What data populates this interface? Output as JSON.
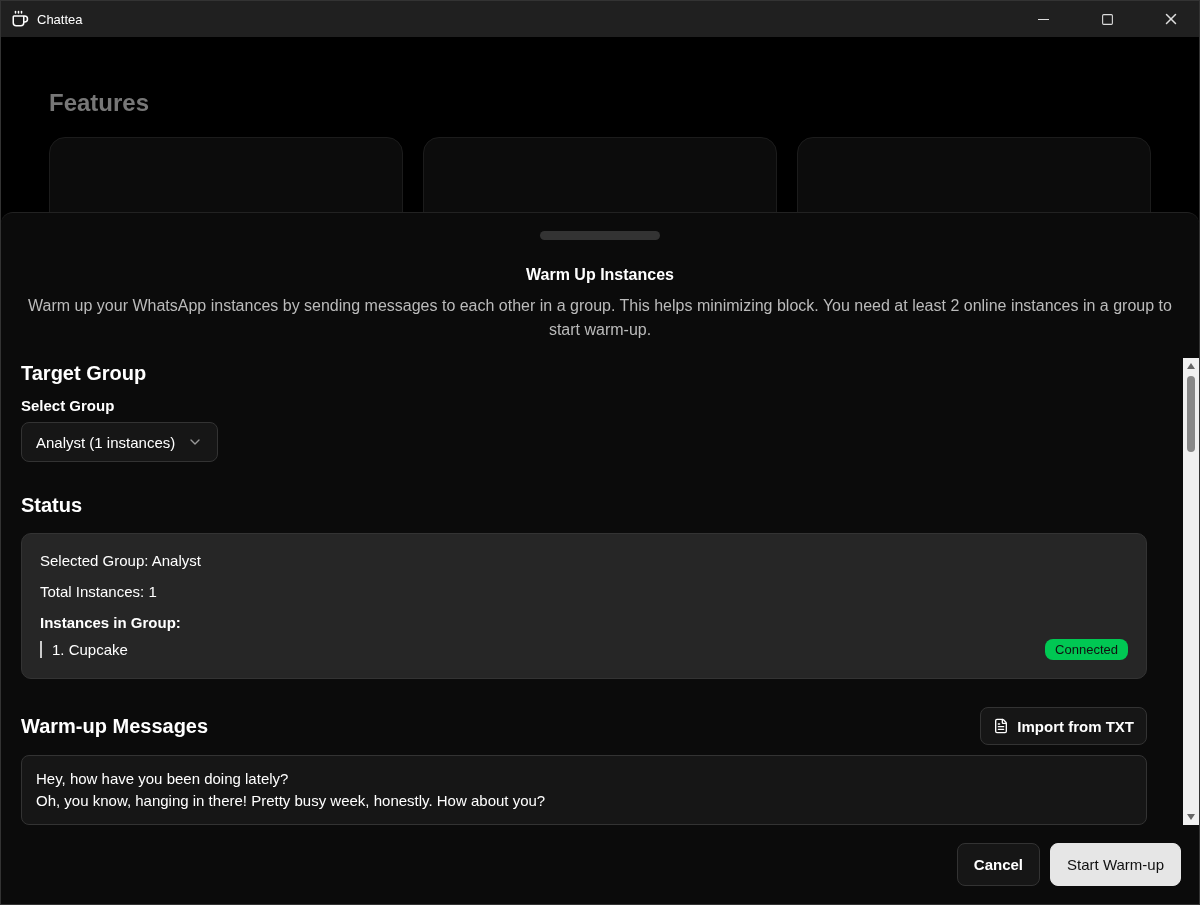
{
  "window": {
    "title": "Chattea"
  },
  "background": {
    "heading": "Features"
  },
  "sheet": {
    "title": "Warm Up Instances",
    "description": "Warm up your WhatsApp instances by sending messages to each other in a group. This helps minimizing block. You need at least 2 online instances in a group to start warm-up."
  },
  "target_group": {
    "heading": "Target Group",
    "label": "Select Group",
    "value": "Analyst (1 instances)"
  },
  "status": {
    "heading": "Status",
    "lines": [
      "Selected Group: Analyst",
      "Total Instances: 1"
    ],
    "instances_heading": "Instances in Group:",
    "instances": [
      {
        "name": "1. Cupcake",
        "status": "Connected",
        "color": "#00c853"
      }
    ]
  },
  "messages": {
    "heading": "Warm-up Messages",
    "import_button": "Import from TXT",
    "lines": [
      "Hey, how have you been doing lately?",
      "Oh, you know, hanging in there! Pretty busy week, honestly. How about you?"
    ]
  },
  "buttons": [
    {
      "label": "Cancel",
      "kind": "secondary"
    },
    {
      "label": "Start Warm-up",
      "kind": "primary"
    }
  ]
}
